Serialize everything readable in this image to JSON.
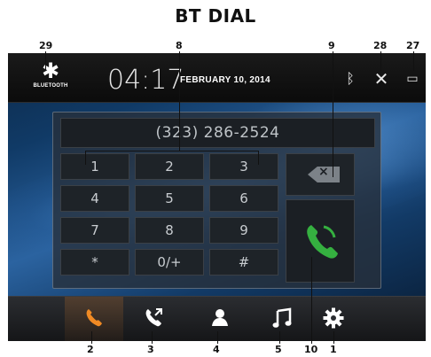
{
  "page_title": "BT DIAL",
  "status_bar": {
    "bluetooth_label": "BLUETOOTH",
    "time": "04:17",
    "date": "FEBRUARY 10, 2014"
  },
  "dialer": {
    "number_display": "(323) 286-2524",
    "keys": [
      "1",
      "2",
      "3",
      "4",
      "5",
      "6",
      "7",
      "8",
      "9",
      "*",
      "0/+",
      "#"
    ],
    "backspace_label": "×"
  },
  "dock": {
    "tabs": [
      {
        "icon": "phone-icon",
        "active": true
      },
      {
        "icon": "recent-calls-icon",
        "active": false
      },
      {
        "icon": "contacts-icon",
        "active": false
      },
      {
        "icon": "music-icon",
        "active": false
      },
      {
        "icon": "settings-icon",
        "active": false
      }
    ]
  },
  "callouts": [
    "29",
    "8",
    "9",
    "28",
    "27",
    "2",
    "3",
    "4",
    "5",
    "10",
    "1"
  ],
  "colors": {
    "accent_orange": "#f08a24",
    "call_green": "#35b040",
    "status_bar": "#0f0f0f",
    "screen_blue": "#1c4f86"
  }
}
